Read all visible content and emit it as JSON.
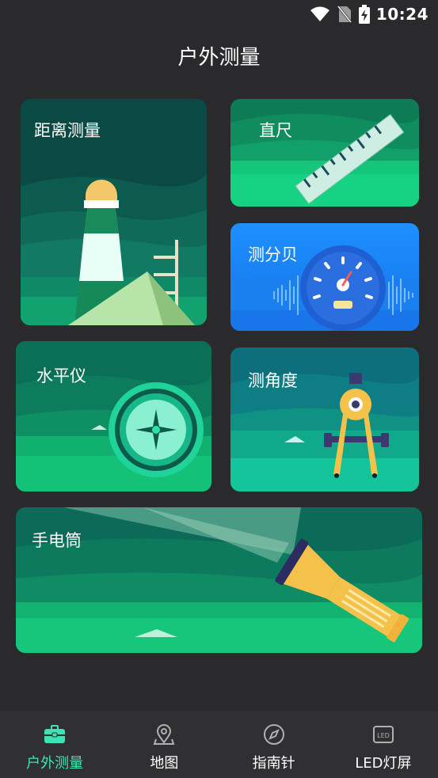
{
  "status_bar": {
    "time": "10:24"
  },
  "header": {
    "title": "户外测量"
  },
  "cards": {
    "distance": {
      "label": "距离测量"
    },
    "ruler": {
      "label": "直尺"
    },
    "decibel": {
      "label": "测分贝"
    },
    "level": {
      "label": "水平仪"
    },
    "angle": {
      "label": "测角度"
    },
    "flashlight": {
      "label": "手电筒"
    }
  },
  "bottom_nav": {
    "items": [
      {
        "label": "户外测量",
        "icon": "briefcase-icon",
        "active": true
      },
      {
        "label": "地图",
        "icon": "map-pin-icon",
        "active": false
      },
      {
        "label": "指南针",
        "icon": "compass-icon",
        "active": false
      },
      {
        "label": "LED灯屏",
        "icon": "led-icon",
        "active": false
      }
    ]
  },
  "colors": {
    "background": "#2a2a2c",
    "accent": "#3ee3b4",
    "nav_background": "#303033",
    "green_card": "#12c47a",
    "blue_card": "#1a8cff"
  }
}
